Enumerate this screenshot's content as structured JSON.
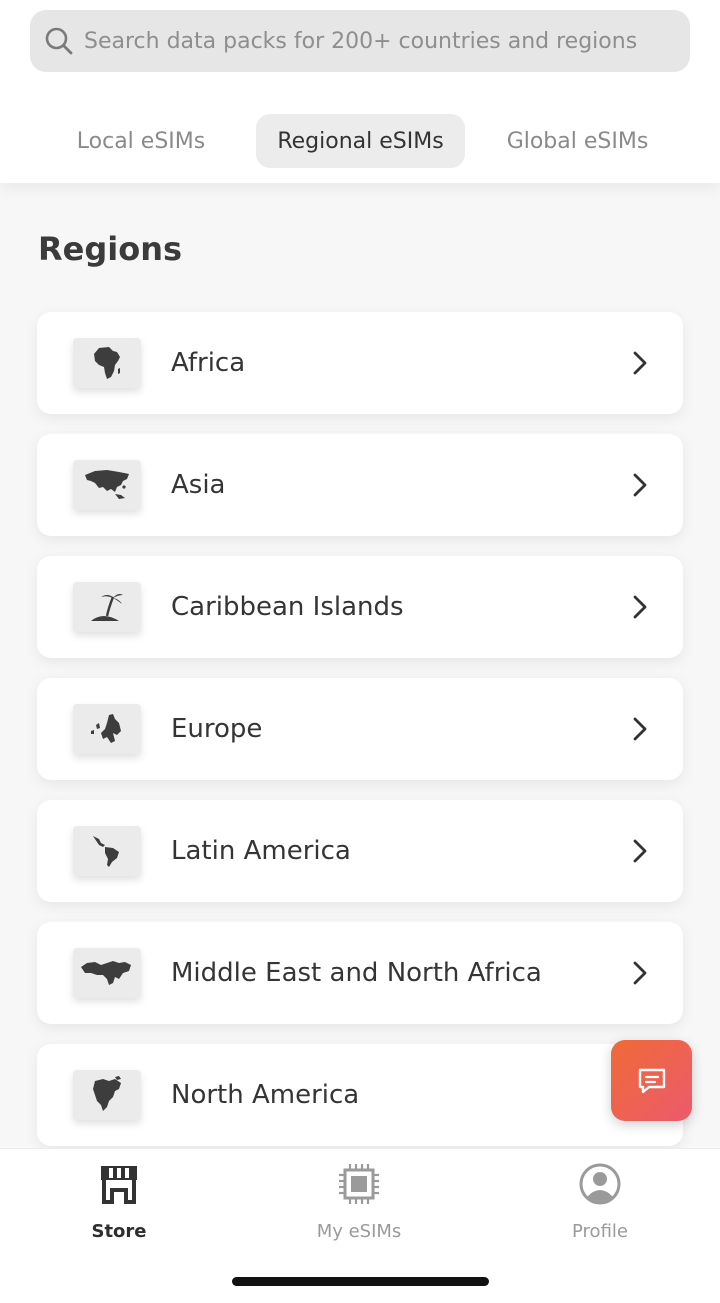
{
  "search": {
    "placeholder": "Search data packs for 200+ countries and regions",
    "value": ""
  },
  "tabs": [
    {
      "label": "Local eSIMs",
      "active": false
    },
    {
      "label": "Regional eSIMs",
      "active": true
    },
    {
      "label": "Global eSIMs",
      "active": false
    }
  ],
  "section": {
    "title": "Regions"
  },
  "regions": [
    {
      "label": "Africa",
      "icon": "africa-map-icon"
    },
    {
      "label": "Asia",
      "icon": "asia-map-icon"
    },
    {
      "label": "Caribbean Islands",
      "icon": "palm-island-icon"
    },
    {
      "label": "Europe",
      "icon": "europe-map-icon"
    },
    {
      "label": "Latin America",
      "icon": "latin-america-map-icon"
    },
    {
      "label": "Middle East and North Africa",
      "icon": "mena-map-icon"
    },
    {
      "label": "North America",
      "icon": "north-america-map-icon"
    }
  ],
  "chat_button": {
    "icon": "chat-icon"
  },
  "bottom_nav": [
    {
      "label": "Store",
      "icon": "store-icon",
      "active": true
    },
    {
      "label": "My eSIMs",
      "icon": "chip-icon",
      "active": false
    },
    {
      "label": "Profile",
      "icon": "profile-icon",
      "active": false
    }
  ],
  "colors": {
    "accent_start": "#f06a35",
    "accent_end": "#ec5a6e",
    "background": "#f7f7f7"
  }
}
